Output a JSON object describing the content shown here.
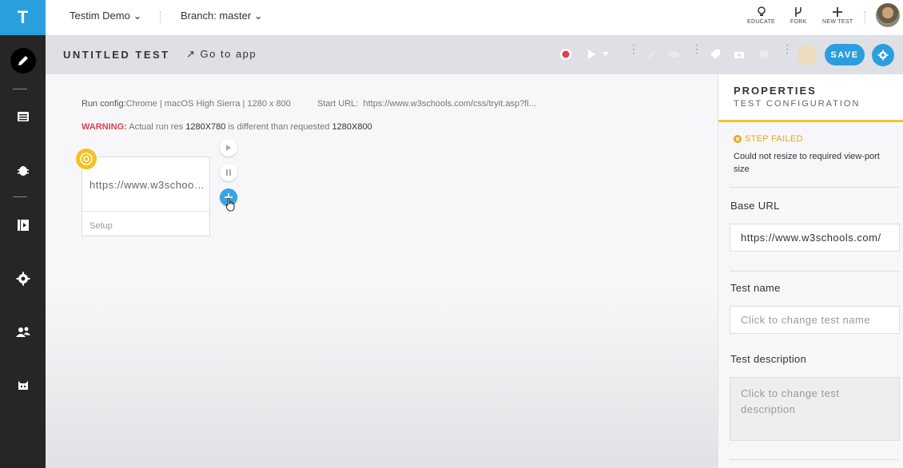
{
  "app": {
    "logo_letter": "T"
  },
  "topbar": {
    "project": "Testim Demo",
    "branch": "Branch: master",
    "educate_label": "EDUCATE",
    "fork_label": "FORK",
    "new_test_label": "NEW TEST"
  },
  "subheader": {
    "title": "UNTITLED TEST",
    "goto_label": "Go to app",
    "save_label": "SAVE"
  },
  "canvas": {
    "run_config_label": "Run config:",
    "run_config_value": "Chrome | macOS High Sierra | 1280 x 800",
    "start_url_label": "Start URL:",
    "start_url_value": "https://www.w3schools.com/css/tryit.asp?fi...",
    "warning_label": "WARNING:",
    "warning_text1": "Actual run res",
    "warning_actual": "1280X780",
    "warning_text2": "is different than requested",
    "warning_requested": "1280X800",
    "step_url": "https://www.w3schools.com",
    "step_setup": "Setup"
  },
  "properties": {
    "title": "PROPERTIES",
    "subtitle": "TEST CONFIGURATION",
    "status": "STEP FAILED",
    "status_message": "Could not resize to required view-port size",
    "base_url_label": "Base URL",
    "base_url_value": "https://www.w3schools.com/",
    "test_name_label": "Test name",
    "test_name_placeholder": "Click to change test name",
    "test_description_label": "Test description",
    "test_description_placeholder": "Click to change test description"
  },
  "colors": {
    "accent": "#2b9ee0",
    "warning": "#d9434e",
    "step_failed": "#e6a817",
    "nav_bg": "#262626"
  }
}
